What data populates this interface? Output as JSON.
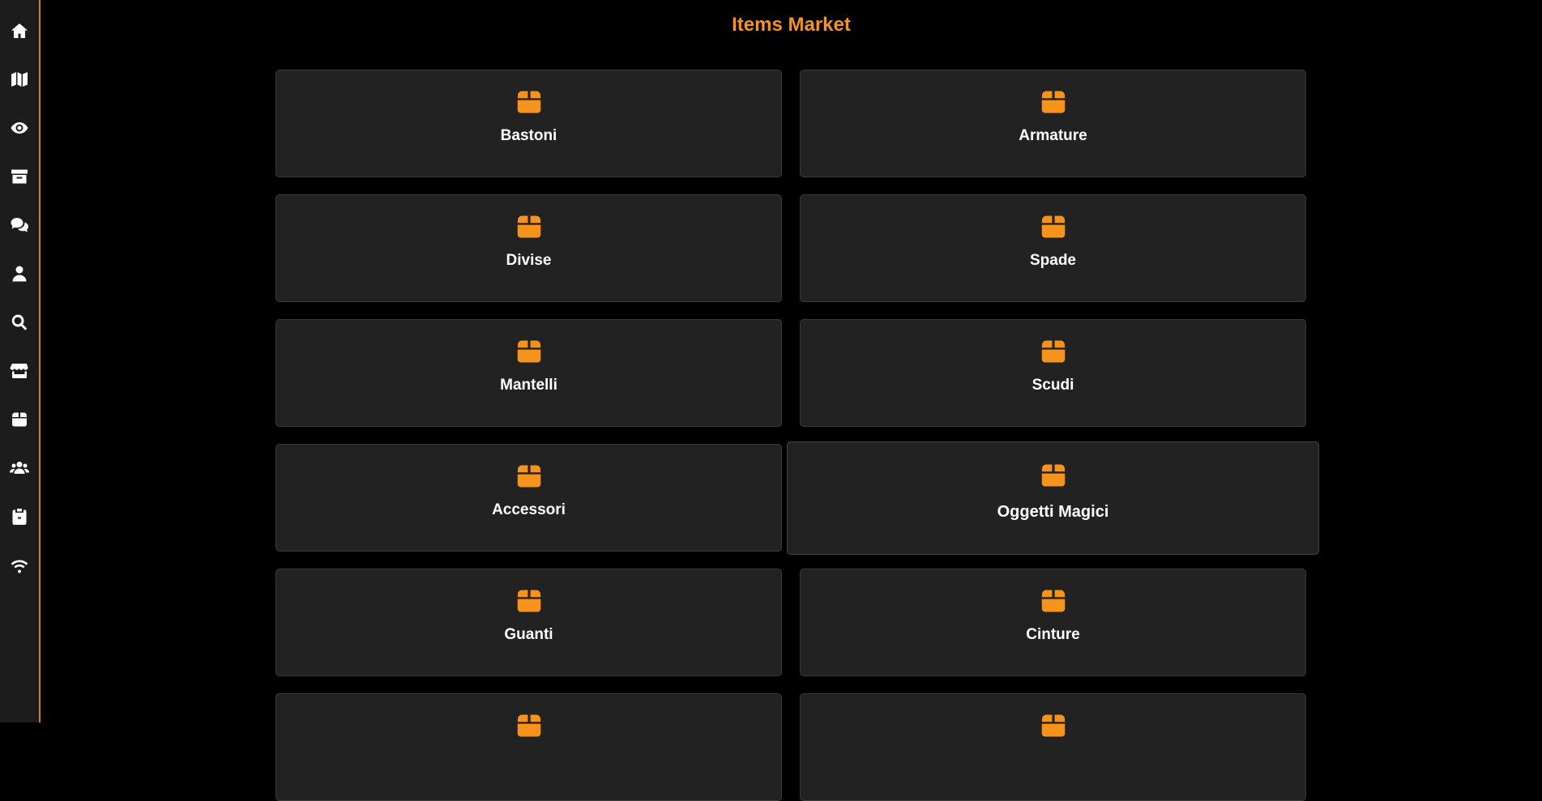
{
  "page": {
    "title": "Items Market"
  },
  "colors": {
    "accent": "#f5931c",
    "sidebar_border": "#e27a1b",
    "card_bg": "#222222",
    "background": "#000000"
  },
  "sidebar": {
    "items": [
      {
        "icon": "home-icon"
      },
      {
        "icon": "map-icon"
      },
      {
        "icon": "eye-icon"
      },
      {
        "icon": "archive-icon"
      },
      {
        "icon": "chat-icon"
      },
      {
        "icon": "user-icon"
      },
      {
        "icon": "search-icon"
      },
      {
        "icon": "store-icon"
      },
      {
        "icon": "box-icon"
      },
      {
        "icon": "users-icon"
      },
      {
        "icon": "clipboard-icon"
      },
      {
        "icon": "wifi-icon"
      }
    ]
  },
  "categories": [
    {
      "label": "Bastoni",
      "icon": "box-icon"
    },
    {
      "label": "Armature",
      "icon": "box-icon"
    },
    {
      "label": "Divise",
      "icon": "box-icon"
    },
    {
      "label": "Spade",
      "icon": "box-icon"
    },
    {
      "label": "Mantelli",
      "icon": "box-icon"
    },
    {
      "label": "Scudi",
      "icon": "box-icon"
    },
    {
      "label": "Accessori",
      "icon": "box-icon"
    },
    {
      "label": "Oggetti Magici",
      "icon": "box-icon"
    },
    {
      "label": "Guanti",
      "icon": "box-icon"
    },
    {
      "label": "Cinture",
      "icon": "box-icon"
    },
    {
      "label": "",
      "icon": "box-icon"
    },
    {
      "label": "",
      "icon": "box-icon"
    }
  ]
}
